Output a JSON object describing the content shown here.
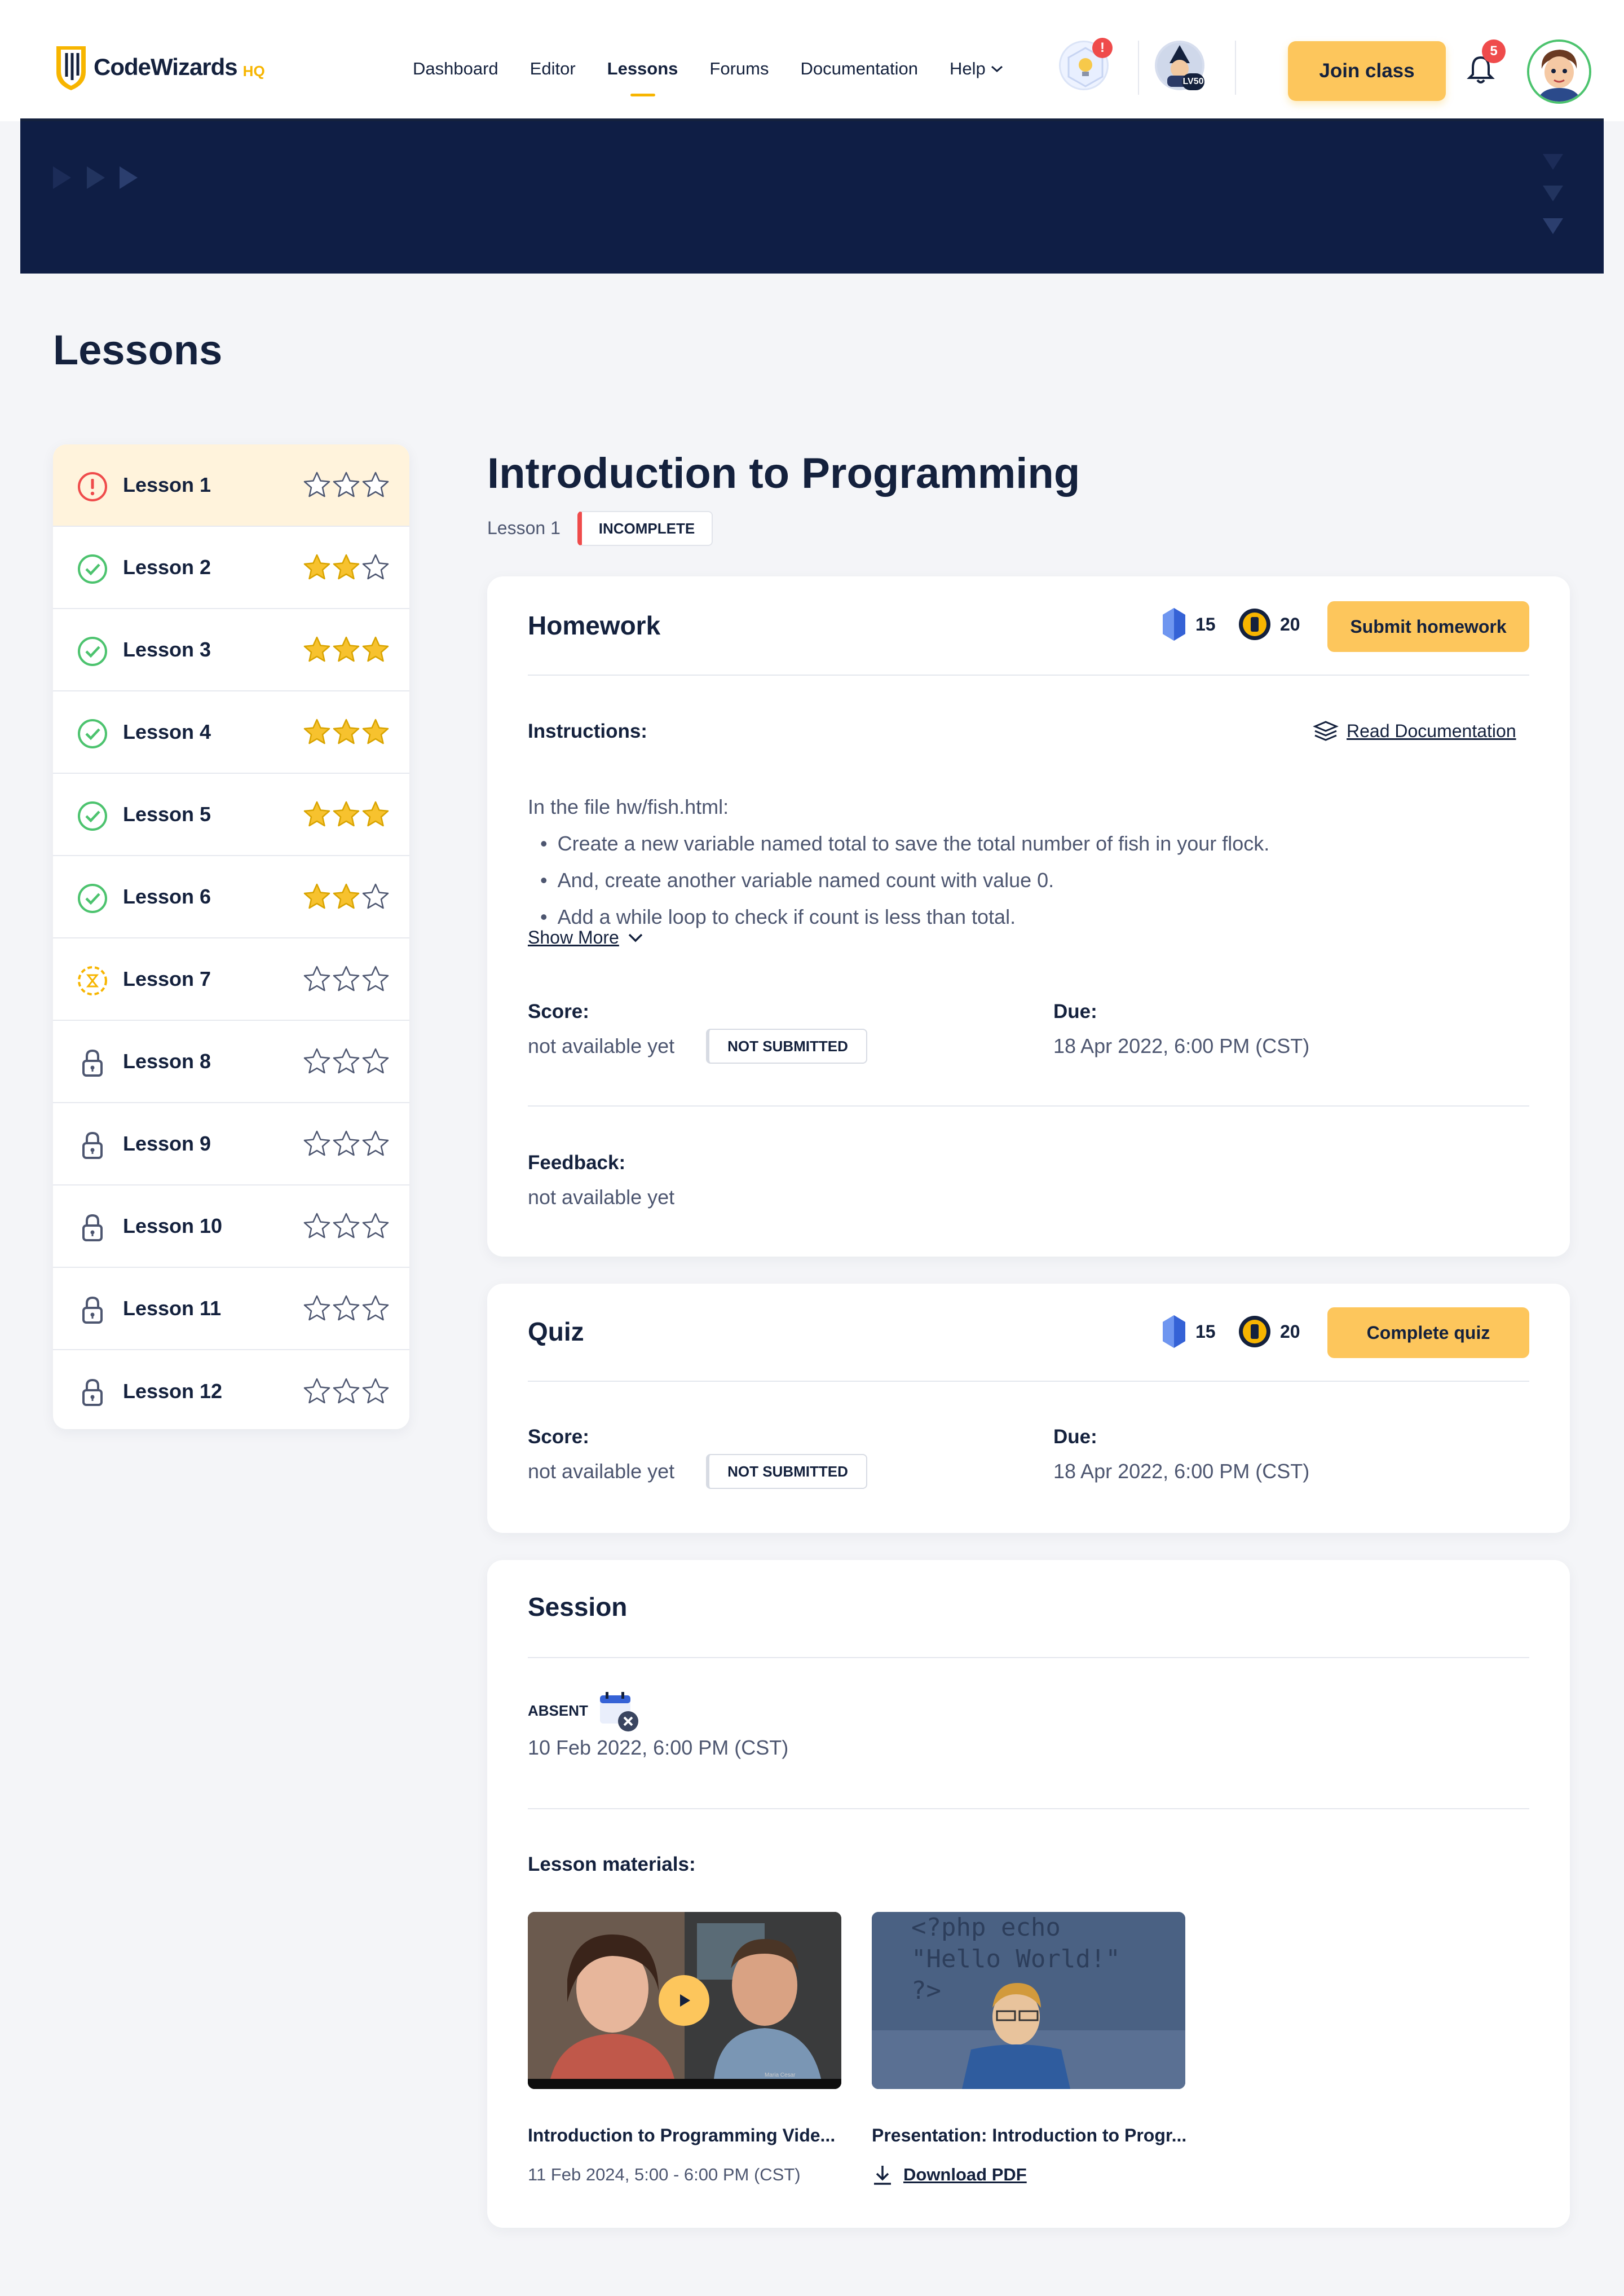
{
  "brand": {
    "name": "CodeWizards",
    "suffix": "HQ",
    "accent": "#f7b500",
    "navy": "#14213d",
    "hero": "#0f1e45"
  },
  "nav": {
    "items": [
      {
        "label": "Dashboard"
      },
      {
        "label": "Editor"
      },
      {
        "label": "Lessons",
        "active": true
      },
      {
        "label": "Forums"
      },
      {
        "label": "Documentation"
      },
      {
        "label": "Help"
      }
    ],
    "hint_icon": "lightbulb-icon",
    "hint_alert": "!",
    "level_badge": "LV50",
    "join_label": "Join class",
    "notifications_count": "5"
  },
  "page_title": "Lessons",
  "lessons": [
    {
      "label": "Lesson 1",
      "status": "incomplete",
      "stars": 0
    },
    {
      "label": "Lesson 2",
      "status": "complete",
      "stars": 2
    },
    {
      "label": "Lesson 3",
      "status": "complete",
      "stars": 3
    },
    {
      "label": "Lesson 4",
      "status": "complete",
      "stars": 3
    },
    {
      "label": "Lesson 5",
      "status": "complete",
      "stars": 3
    },
    {
      "label": "Lesson 6",
      "status": "complete",
      "stars": 2
    },
    {
      "label": "Lesson 7",
      "status": "in-progress",
      "stars": 0
    },
    {
      "label": "Lesson 8",
      "status": "locked",
      "stars": 0
    },
    {
      "label": "Lesson 9",
      "status": "locked",
      "stars": 0
    },
    {
      "label": "Lesson 10",
      "status": "locked",
      "stars": 0
    },
    {
      "label": "Lesson 11",
      "status": "locked",
      "stars": 0
    },
    {
      "label": "Lesson 12",
      "status": "locked",
      "stars": 0
    }
  ],
  "detail": {
    "title": "Introduction to Programming",
    "lesson_label": "Lesson 1",
    "status_badge": "INCOMPLETE"
  },
  "homework": {
    "title": "Homework",
    "gems": "15",
    "coins": "20",
    "button": "Submit homework",
    "instructions_label": "Instructions:",
    "doc_link": "Read Documentation",
    "intro": "In the file hw/fish.html:",
    "bullets": [
      "Create a new variable named total to save the total number of fish in your flock.",
      "And, create another variable named count with value 0.",
      "Add a while loop to check if count is less than total."
    ],
    "show_more": "Show More",
    "score_label": "Score:",
    "score_value": "not available yet",
    "score_badge": "NOT SUBMITTED",
    "due_label": "Due:",
    "due_value": "18 Apr 2022, 6:00 PM (CST)",
    "feedback_label": "Feedback:",
    "feedback_value": "not available yet"
  },
  "quiz": {
    "title": "Quiz",
    "gems": "15",
    "coins": "20",
    "button": "Complete quiz",
    "score_label": "Score:",
    "score_value": "not available yet",
    "score_badge": "NOT SUBMITTED",
    "due_label": "Due:",
    "due_value": "18 Apr 2022, 6:00 PM (CST)"
  },
  "session": {
    "title": "Session",
    "attendance": "ABSENT",
    "date": "10 Feb 2022, 6:00 PM (CST)",
    "materials_label": "Lesson materials:",
    "materials": [
      {
        "title": "Introduction to Programming Vide...",
        "sub": "11 Feb 2024, 5:00 - 6:00 PM (CST)",
        "thumb_caption": "Maria Cesar"
      },
      {
        "title": "Presentation: Introduction to Progr...",
        "sub": "Download PDF",
        "thumb_code": "<?php echo\n\"Hello World!\"\n?>"
      }
    ]
  }
}
